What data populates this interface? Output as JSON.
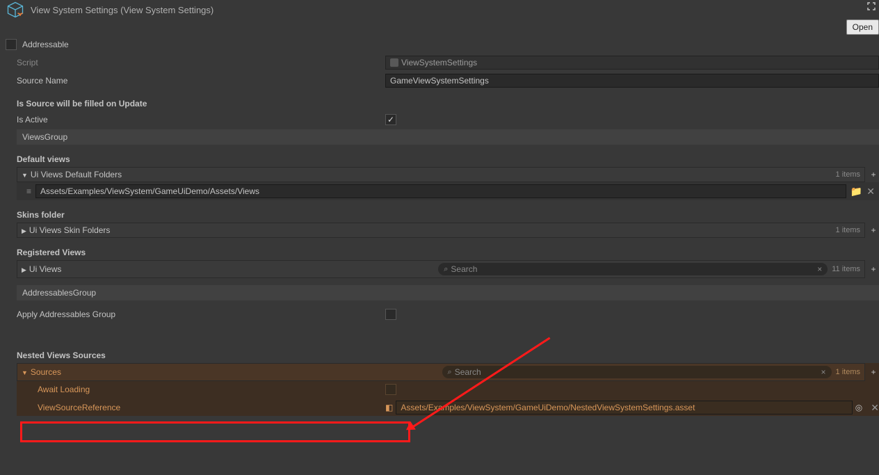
{
  "header": {
    "title": "View System Settings (View System Settings)",
    "open_label": "Open"
  },
  "addressable": {
    "label": "Addressable",
    "checked": false
  },
  "fields": {
    "script_label": "Script",
    "script_value": "ViewSystemSettings",
    "source_name_label": "Source Name",
    "source_name_value": "GameViewSystemSettings",
    "is_source_label": "Is Source will be filled on Update",
    "is_active_label": "Is Active",
    "is_active_checked": true
  },
  "views_group": {
    "title": "ViewsGroup",
    "default_views": {
      "title": "Default views",
      "list_name": "Ui Views Default Folders",
      "count": "1 items",
      "items": [
        "Assets/Examples/ViewSystem/GameUiDemo/Assets/Views"
      ]
    },
    "skins_folder": {
      "title": "Skins folder",
      "list_name": "Ui Views Skin Folders",
      "count": "1 items"
    },
    "registered_views": {
      "title": "Registered Views",
      "list_name": "Ui Views",
      "search_placeholder": "Search",
      "count": "11 items"
    }
  },
  "addressables_group": {
    "title": "AddressablesGroup",
    "apply_label": "Apply Addressables Group",
    "apply_checked": false
  },
  "nested_views": {
    "title": "Nested Views Sources",
    "list_name": "Sources",
    "search_placeholder": "Search",
    "count": "1 items",
    "await_loading_label": "Await Loading",
    "await_loading_checked": false,
    "view_source_ref_label": "ViewSourceReference",
    "view_source_ref_value": "Assets/Examples/ViewSystem/GameUiDemo/NestedViewSystemSettings.asset"
  }
}
